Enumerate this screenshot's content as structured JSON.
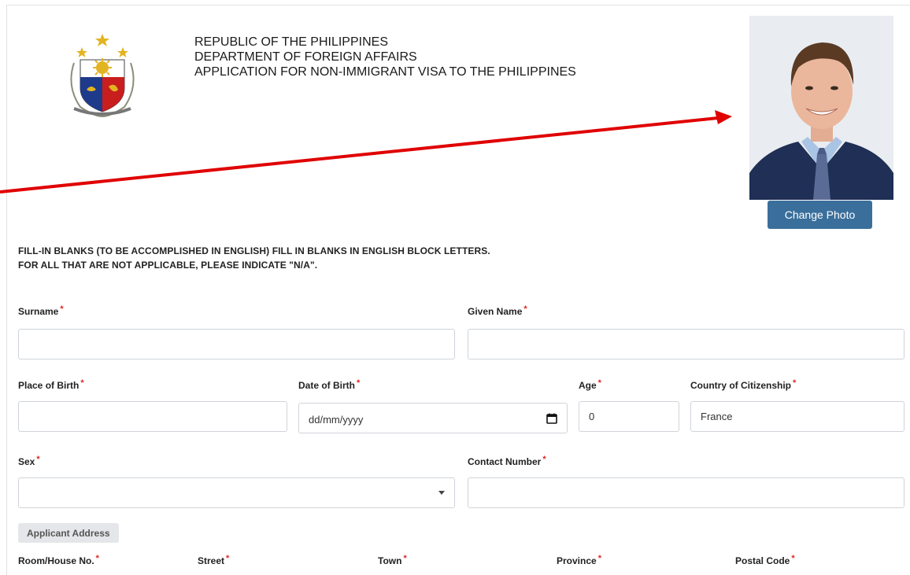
{
  "header": {
    "line1": "REPUBLIC OF THE PHILIPPINES",
    "line2": "DEPARTMENT OF FOREIGN AFFAIRS",
    "line3": "APPLICATION FOR NON-IMMIGRANT VISA TO THE PHILIPPINES",
    "seal_text": "REPUBLIC OF THE PHILIPPINES"
  },
  "photo": {
    "change_label": "Change Photo"
  },
  "instructions": {
    "line1": "FILL-IN BLANKS (TO BE ACCOMPLISHED IN ENGLISH) FILL IN BLANKS IN ENGLISH BLOCK LETTERS.",
    "line2": "FOR ALL THAT ARE NOT APPLICABLE, PLEASE INDICATE \"N/A\"."
  },
  "form": {
    "required_mark": "*",
    "surname": {
      "label": "Surname",
      "value": ""
    },
    "given_name": {
      "label": "Given Name",
      "value": ""
    },
    "place_of_birth": {
      "label": "Place of Birth",
      "value": ""
    },
    "date_of_birth": {
      "label": "Date of Birth",
      "placeholder": "dd/mm/yyyy"
    },
    "age": {
      "label": "Age",
      "value": "0"
    },
    "country_of_citizenship": {
      "label": "Country of Citizenship",
      "value": "France"
    },
    "sex": {
      "label": "Sex",
      "value": ""
    },
    "contact_number": {
      "label": "Contact Number",
      "value": ""
    },
    "applicant_address_section": "Applicant Address",
    "room_house_no": {
      "label": "Room/House No."
    },
    "street": {
      "label": "Street"
    },
    "town": {
      "label": "Town"
    },
    "province": {
      "label": "Province"
    },
    "postal_code": {
      "label": "Postal Code"
    }
  },
  "colors": {
    "button_bg": "#3a6f9c",
    "required": "#e02424",
    "annotation_arrow": "#e00000"
  },
  "icons": [
    "calendar-icon",
    "dropdown-caret-icon",
    "philippine-seal-logo"
  ]
}
